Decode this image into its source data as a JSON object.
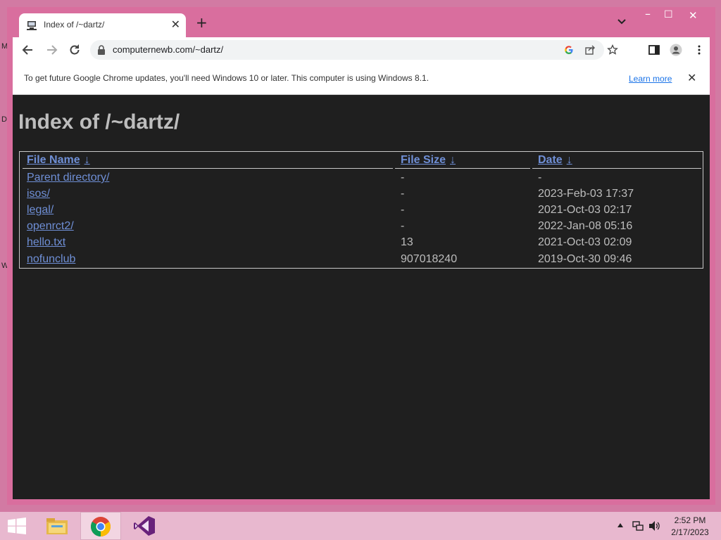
{
  "desktop": {
    "edge_letters": [
      "M",
      "D",
      "W"
    ]
  },
  "browser": {
    "tab": {
      "title": "Index of /~dartz/"
    },
    "new_tab_label": "+",
    "window_controls": {
      "minimize": "–",
      "maximize": "☐",
      "close": "✕"
    },
    "address": {
      "url": "computernewb.com/~dartz/"
    }
  },
  "infobar": {
    "message": "To get future Google Chrome updates, you'll need Windows 10 or later. This computer is using Windows 8.1.",
    "link": "Learn more",
    "close": "✕"
  },
  "page": {
    "heading": "Index of /~dartz/",
    "columns": [
      {
        "label": "File Name",
        "arrow": "↓"
      },
      {
        "label": "File Size",
        "arrow": "↓"
      },
      {
        "label": "Date",
        "arrow": "↓"
      }
    ],
    "rows": [
      {
        "name": "Parent directory/",
        "size": "-",
        "date": "-"
      },
      {
        "name": "isos/",
        "size": "-",
        "date": "2023-Feb-03 17:37"
      },
      {
        "name": "legal/",
        "size": "-",
        "date": "2021-Oct-03 02:17"
      },
      {
        "name": "openrct2/",
        "size": "-",
        "date": "2022-Jan-08 05:16"
      },
      {
        "name": "hello.txt",
        "size": "13",
        "date": "2021-Oct-03 02:09"
      },
      {
        "name": "nofunclub",
        "size": "907018240",
        "date": "2019-Oct-30 09:46"
      }
    ]
  },
  "taskbar": {
    "apps": [
      "file-explorer-icon",
      "chrome-icon",
      "visual-studio-icon"
    ],
    "time": "2:52 PM",
    "date": "2/17/2023"
  },
  "colors": {
    "frame": "#d96e9e",
    "page_background": "#1f1f1f",
    "link": "#6f8fd6",
    "text": "#bdbdbd"
  }
}
